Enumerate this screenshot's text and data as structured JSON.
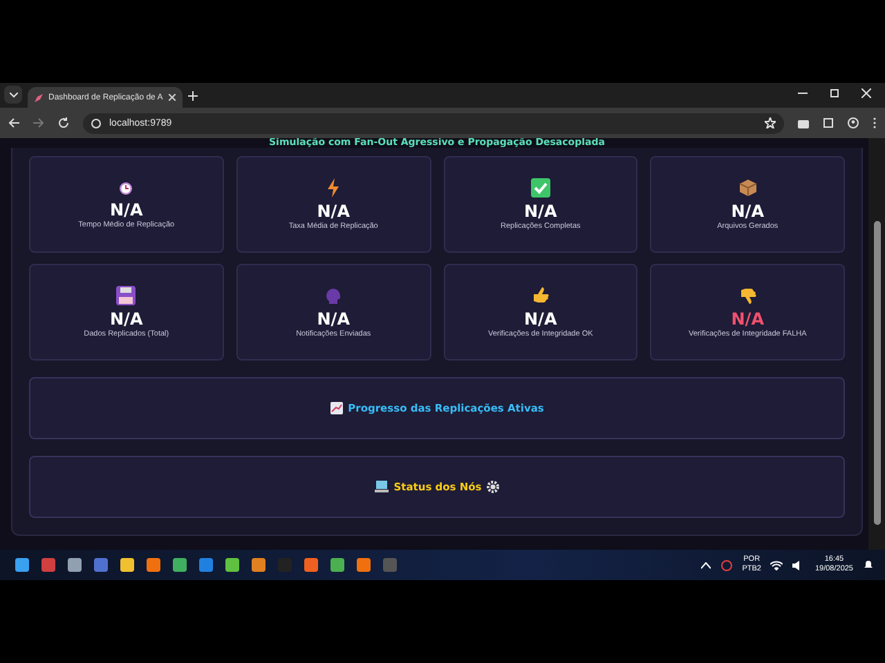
{
  "browser": {
    "tab": {
      "title": "Dashboard de Replicação de A",
      "selected": true
    },
    "address": "localhost:9789"
  },
  "page": {
    "subtitle": "Simulação com Fan-Out Agressivo e Propagação Desacoplada",
    "metrics": [
      {
        "value": "N/A",
        "label": "Tempo Médio de Replicação",
        "alert": false
      },
      {
        "value": "N/A",
        "label": "Taxa Média de Replicação",
        "alert": false
      },
      {
        "value": "N/A",
        "label": "Replicações Completas",
        "alert": false
      },
      {
        "value": "N/A",
        "label": "Arquivos Gerados",
        "alert": false
      },
      {
        "value": "N/A",
        "label": "Dados Replicados (Total)",
        "alert": false
      },
      {
        "value": "N/A",
        "label": "Notificações Enviadas",
        "alert": false
      },
      {
        "value": "N/A",
        "label": "Verificações de Integridade OK",
        "alert": false
      },
      {
        "value": "N/A",
        "label": "Verificações de Integridade FALHA",
        "alert": true
      }
    ],
    "sections": [
      {
        "title": "Progresso das Replicações Ativas",
        "kind": "progress"
      },
      {
        "title": "Status dos Nós",
        "kind": "nodes"
      }
    ]
  },
  "taskbar": {
    "language": "POR",
    "layout": "PTB2",
    "time": "16:45",
    "date": "19/08/2025"
  }
}
